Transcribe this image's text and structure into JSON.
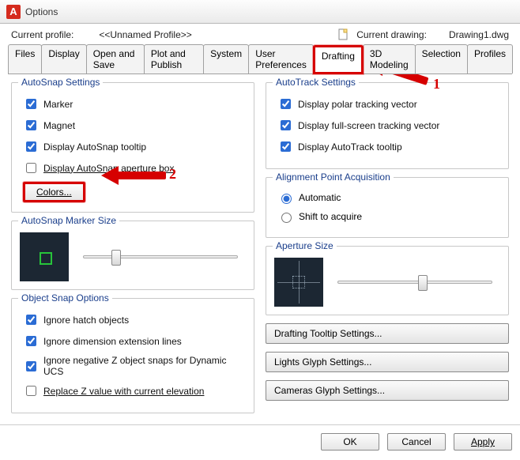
{
  "window": {
    "title": "Options",
    "app_icon_letter": "A"
  },
  "profile_row": {
    "current_profile_label": "Current profile:",
    "current_profile_value": "<<Unnamed Profile>>",
    "current_drawing_label": "Current drawing:",
    "current_drawing_value": "Drawing1.dwg"
  },
  "tabs": {
    "items": [
      "Files",
      "Display",
      "Open and Save",
      "Plot and Publish",
      "System",
      "User Preferences",
      "Drafting",
      "3D Modeling",
      "Selection",
      "Profiles"
    ],
    "active_index": 6
  },
  "autosnap": {
    "title": "AutoSnap Settings",
    "marker": "Marker",
    "magnet": "Magnet",
    "tooltip": "Display AutoSnap tooltip",
    "aperture": "Display AutoSnap aperture box",
    "colors_btn": "Colors..."
  },
  "autosnap_marker": {
    "title": "AutoSnap Marker Size"
  },
  "object_snap": {
    "title": "Object Snap Options",
    "ignore_hatch": "Ignore hatch objects",
    "ignore_dim": "Ignore dimension extension lines",
    "ignore_z": "Ignore negative Z object snaps for Dynamic UCS",
    "replace_z": "Replace Z value with current elevation"
  },
  "autotrack": {
    "title": "AutoTrack Settings",
    "polar": "Display polar tracking vector",
    "fullscreen": "Display full-screen tracking vector",
    "tooltip": "Display AutoTrack tooltip"
  },
  "alignment": {
    "title": "Alignment Point Acquisition",
    "automatic": "Automatic",
    "shift": "Shift to acquire"
  },
  "aperture": {
    "title": "Aperture Size"
  },
  "buttons_right": {
    "tooltip": "Drafting Tooltip Settings...",
    "lights": "Lights Glyph Settings...",
    "cameras": "Cameras Glyph Settings..."
  },
  "footer": {
    "ok": "OK",
    "cancel": "Cancel",
    "apply": "Apply"
  },
  "annotations": {
    "num1": "1",
    "num2": "2"
  }
}
